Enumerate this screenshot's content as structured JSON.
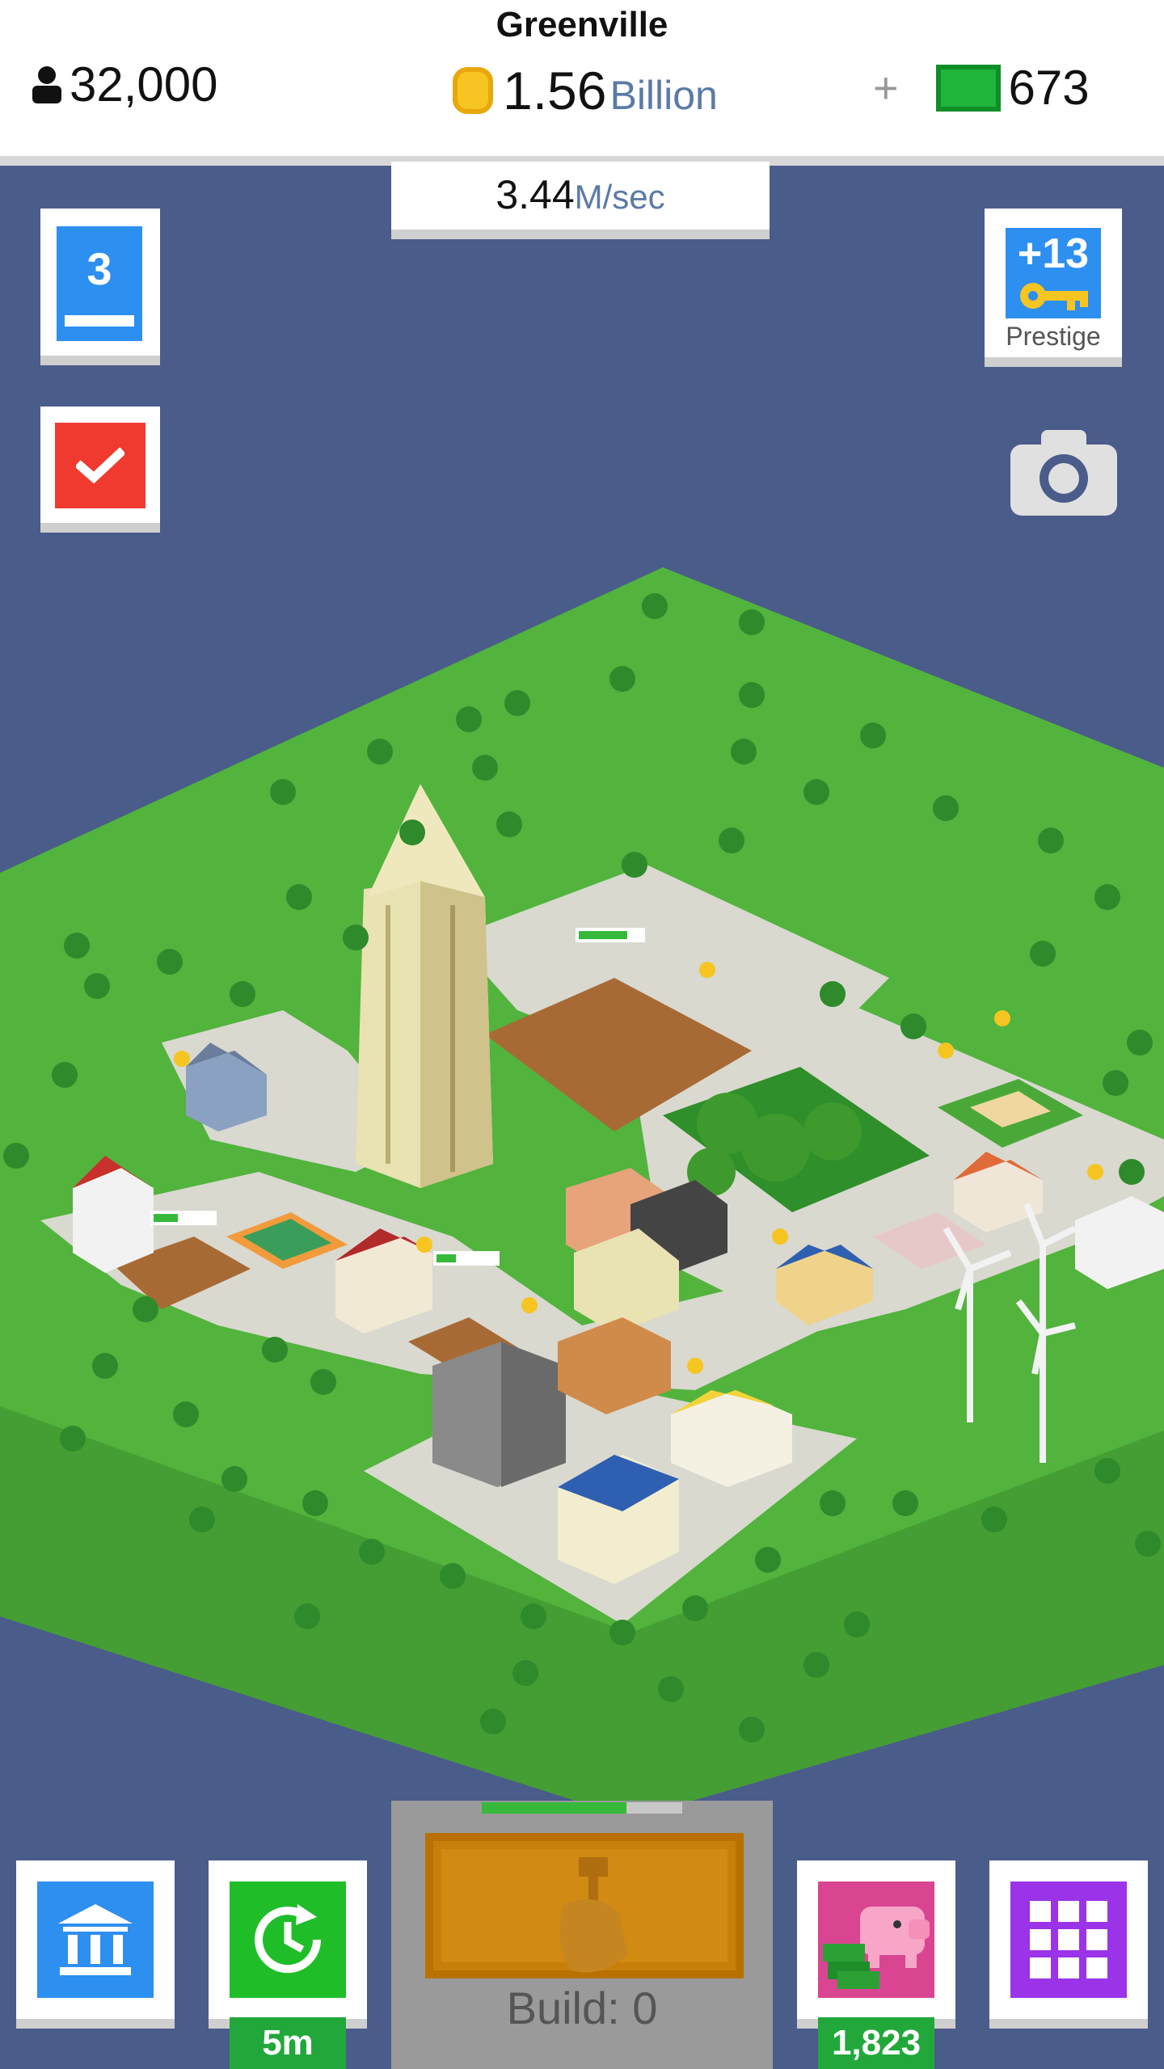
{
  "header": {
    "city_name": "Greenville",
    "population": "32,000",
    "money_value": "1.56",
    "money_unit": "Billion",
    "cash_plus": "+",
    "cash_value": "673",
    "rate_value": "3.44",
    "rate_unit": "M/sec"
  },
  "left_buttons": {
    "level": "3",
    "level_icon": "level-book-icon",
    "tasks_icon": "checkmark-icon"
  },
  "right_buttons": {
    "prestige_count": "+13",
    "prestige_label": "Prestige",
    "prestige_icon": "key-icon",
    "camera_icon": "camera-icon"
  },
  "bottom_bar": {
    "bank_icon": "bank-icon",
    "boost_icon": "clock-refresh-icon",
    "boost_badge": "5m",
    "build_label": "Build: 0",
    "build_icon": "hammer-hand-icon",
    "build_progress": 0.72,
    "piggy_icon": "piggy-bank-icon",
    "piggy_badge": "1,823",
    "menu_icon": "grid-menu-icon"
  },
  "colors": {
    "background": "#4a5c8a",
    "grass": "#4caf3a",
    "road": "#d9d9d0",
    "blue_button": "#2d8ff0",
    "red_button": "#f03a2f",
    "green_button": "#1fbe29",
    "pink_button": "#d94590",
    "purple_button": "#9b33e8",
    "coin": "#f6c521",
    "cash": "#1fb53b"
  }
}
